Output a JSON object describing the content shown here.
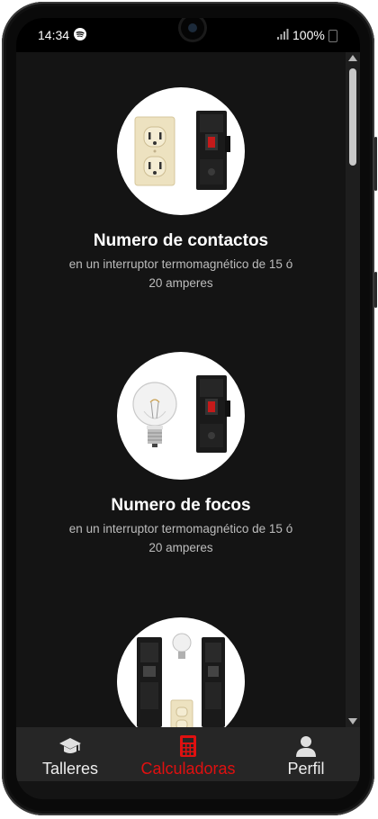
{
  "status_bar": {
    "time": "14:34",
    "battery": "100%"
  },
  "cards": [
    {
      "title": "Numero de contactos",
      "desc_line1": "en un interruptor termomagnético de 15 ó",
      "desc_line2": "20 amperes",
      "image": "outlet-and-breaker"
    },
    {
      "title": "Numero de focos",
      "desc_line1": "en un interruptor termomagnético de 15 ó",
      "desc_line2": "20 amperes",
      "image": "bulb-and-breaker"
    },
    {
      "title": "",
      "image": "breakers-bulb-outlet"
    }
  ],
  "nav": {
    "items": [
      {
        "label": "Talleres",
        "icon": "graduation-cap-icon",
        "active": false
      },
      {
        "label": "Calculadoras",
        "icon": "calculator-icon",
        "active": true
      },
      {
        "label": "Perfil",
        "icon": "person-icon",
        "active": false
      }
    ]
  },
  "colors": {
    "accent": "#e01010",
    "background": "#141414",
    "nav_background": "#262626"
  }
}
